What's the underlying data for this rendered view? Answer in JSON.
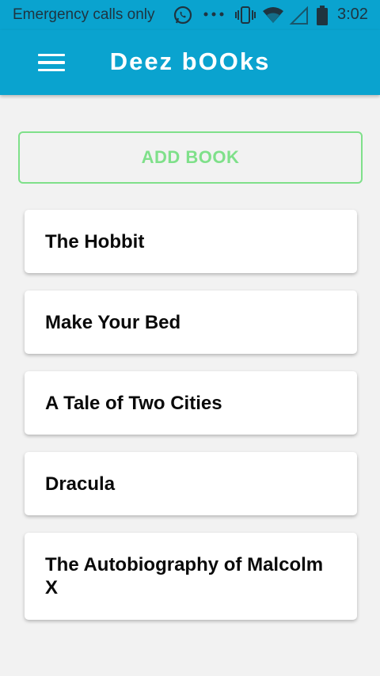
{
  "status_bar": {
    "carrier_text": "Emergency calls only",
    "time": "3:02",
    "icons": [
      "whatsapp-icon",
      "more-dots-icon",
      "vibrate-icon",
      "wifi-icon",
      "signal-icon",
      "battery-icon"
    ]
  },
  "app_bar": {
    "title": "Deez bOOks",
    "menu_icon": "hamburger-menu-icon",
    "color": "#0aa3cf"
  },
  "add_button": {
    "label": "ADD BOOK",
    "color": "#7fe08a"
  },
  "books": [
    {
      "title": "The Hobbit"
    },
    {
      "title": "Make Your Bed"
    },
    {
      "title": "A Tale of Two Cities"
    },
    {
      "title": "Dracula"
    },
    {
      "title": "The Autobiography of Malcolm X"
    }
  ]
}
